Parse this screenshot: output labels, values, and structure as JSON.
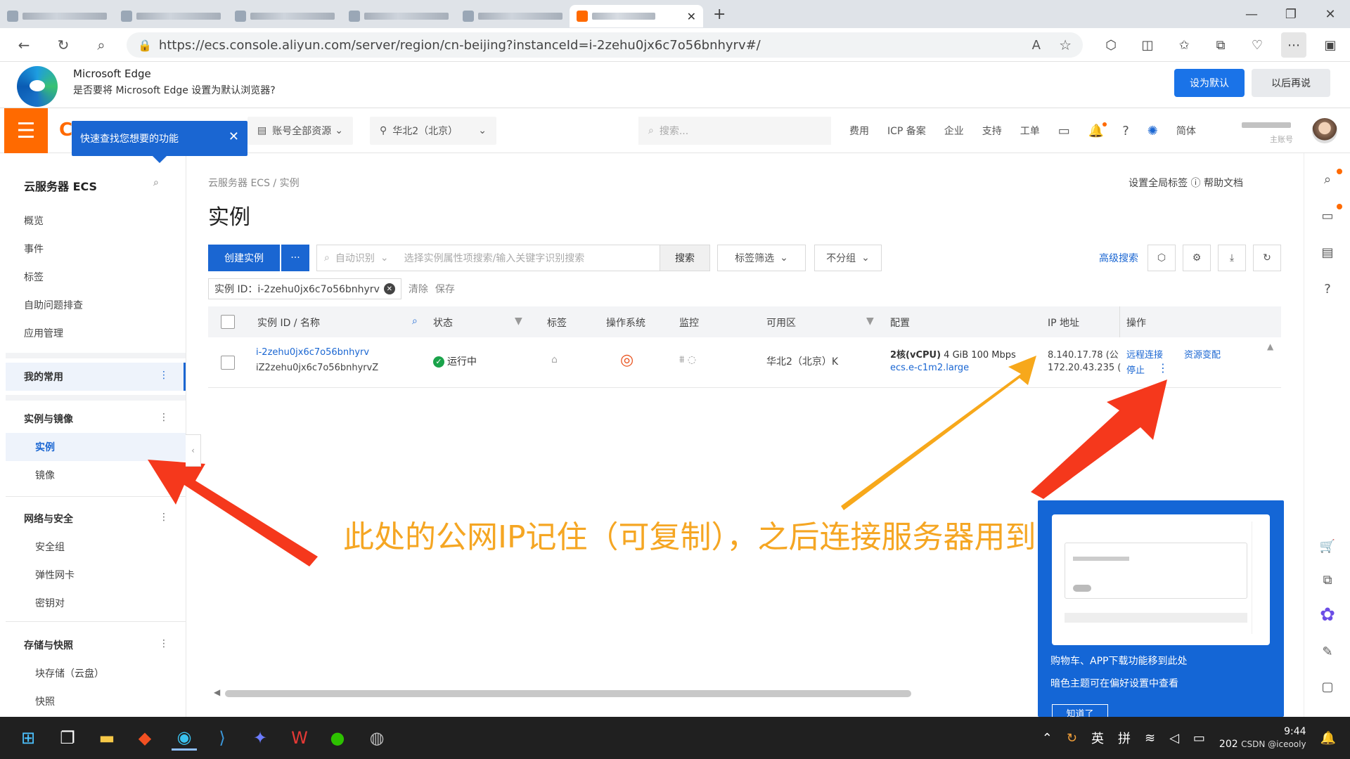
{
  "browser": {
    "url": "https://ecs.console.aliyun.com/server/region/cn-beijing?instanceId=i-2zehu0jx6c7o56bnhyrv#/"
  },
  "infobar": {
    "title": "Microsoft Edge",
    "message": "是否要将 Microsoft Edge 设置为默认浏览器?",
    "primary": "设为默认",
    "secondary": "以后再说"
  },
  "console": {
    "tooltip": "快速查找您想要的功能",
    "tooltip_close": "✕",
    "resource_select": "账号全部资源",
    "region_select": "华北2（北京）",
    "search_placeholder": "搜索...",
    "nav": [
      "费用",
      "ICP 备案",
      "企业",
      "支持",
      "工单"
    ],
    "lang": "简体",
    "account_sub": "主账号"
  },
  "sidebar": {
    "title": "云服务器 ECS",
    "top_items": [
      "概览",
      "事件",
      "标签",
      "自助问题排查",
      "应用管理"
    ],
    "favorites": "我的常用",
    "section_instances": "实例与镜像",
    "instances_items": [
      "实例",
      "镜像"
    ],
    "section_network": "网络与安全",
    "network_items": [
      "安全组",
      "弹性网卡",
      "密钥对"
    ],
    "section_storage": "存储与快照",
    "storage_items": [
      "块存储（云盘）",
      "快照"
    ]
  },
  "main": {
    "breadcrumb": "云服务器 ECS  /  实例",
    "title": "实例",
    "top_right": "设置全局标签  ⓘ 帮助文档",
    "create_btn": "创建实例",
    "more_btn": "···",
    "auto_identify": "自动识别",
    "search_placeholder": "选择实例属性项搜索/输入关键字识别搜索",
    "search_btn": "搜索",
    "tag_filter": "标签筛选",
    "group": "不分组",
    "advanced": "高级搜索",
    "filter_chip": "实例 ID：i-2zehu0jx6c7o56bnhyrv",
    "clear": "清除",
    "save": "保存",
    "columns": [
      "实例 ID / 名称",
      "状态",
      "标签",
      "操作系统",
      "监控",
      "可用区",
      "配置",
      "IP 地址",
      "操作"
    ],
    "row": {
      "id": "i-2zehu0jx6c7o56bnhyrv",
      "name": "iZ2zehu0jx6c7o56bnhyrvZ",
      "status": "运行中",
      "zone": "华北2（北京）K",
      "config_cpu": "2核(vCPU)",
      "config_mem": "4 GiB 100 Mbps",
      "config_type": "ecs.e-c1m2.large",
      "ip_public": "8.140.17.78 (公",
      "ip_private": "172.20.43.235 (",
      "action_remote": "远程连接",
      "action_change": "资源变配",
      "action_stop": "停止"
    }
  },
  "popup": {
    "line1": "购物车、APP下载功能移到此处",
    "line2": "暗色主题可在偏好设置中查看",
    "ok": "知道了"
  },
  "annotation": "此处的公网IP记住（可复制），之后连接服务器用到",
  "taskbar": {
    "ime": "英",
    "ime2": "拼",
    "time": "9:44",
    "date": "202",
    "watermark": "CSDN @iceooly"
  }
}
